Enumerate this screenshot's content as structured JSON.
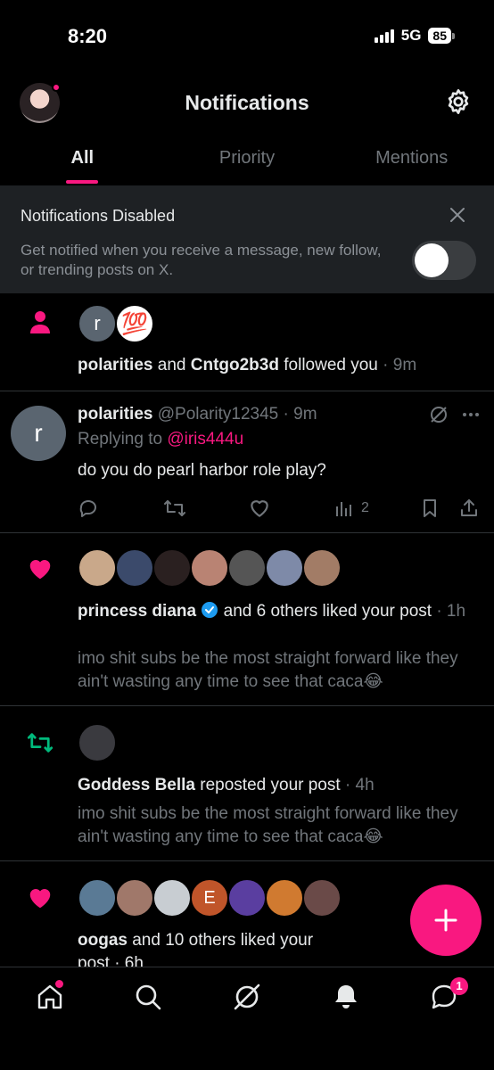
{
  "status_bar": {
    "time": "8:20",
    "network": "5G",
    "battery": "85"
  },
  "header": {
    "title": "Notifications"
  },
  "tabs": [
    {
      "label": "All",
      "active": true
    },
    {
      "label": "Priority",
      "active": false
    },
    {
      "label": "Mentions",
      "active": false
    }
  ],
  "banner": {
    "title": "Notifications Disabled",
    "text": "Get notified when you receive a message, new follow, or trending posts on X.",
    "toggle_on": false
  },
  "notifications": [
    {
      "type": "follow",
      "avatar_letter": "r",
      "emoji": "💯",
      "user1": "polarities",
      "and": " and ",
      "user2": "Cntgo2b3d",
      "action": " followed you",
      "time": " · 9m"
    },
    {
      "type": "reply",
      "avatar_letter": "r",
      "name": "polarities",
      "handle": "@Polarity12345",
      "time": "· 9m",
      "replying_to_label": "Replying to ",
      "replying_to": "@iris444u",
      "text": "do you do pearl harbor role play?",
      "views": "2"
    },
    {
      "type": "like",
      "user": "princess diana",
      "verified": true,
      "action": " and 6 others liked your post",
      "time": "· 1h",
      "post_text": "imo shit subs be the most straight forward like they ain't wasting any time to see that caca😂"
    },
    {
      "type": "repost",
      "user": "Goddess Bella",
      "action": " reposted your post",
      "time": " · 4h",
      "post_text": "imo shit subs be the most straight forward like they ain't wasting any time to see that caca😂"
    },
    {
      "type": "like",
      "user": "oogas",
      "action": " and 10 others liked your",
      "action2": "post · 6h",
      "avatar_letter": "E"
    }
  ],
  "bottom_nav": {
    "messages_badge": "1"
  },
  "colors": {
    "accent": "#f91880",
    "repost": "#00ba7c",
    "background": "#000000",
    "banner_bg": "#1e2124"
  }
}
